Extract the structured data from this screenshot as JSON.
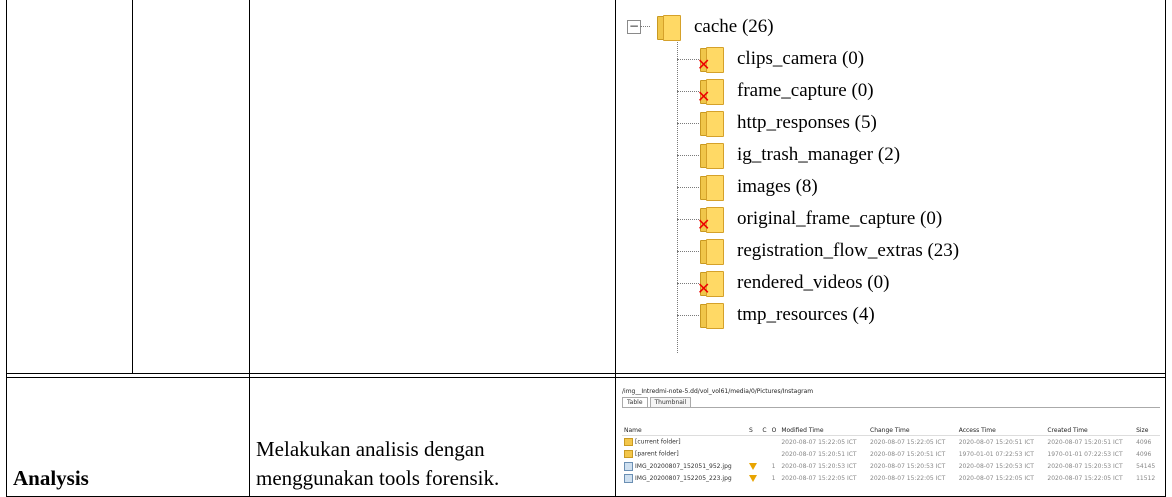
{
  "table": {
    "analysis_label": "Analysis",
    "analysis_desc_line1": "Melakukan analisis dengan",
    "analysis_desc_line2": "menggunakan tools forensik."
  },
  "tree": {
    "expander_symbol": "−",
    "root": "cache (26)",
    "children": [
      {
        "label": "clips_camera (0)",
        "deleted": true
      },
      {
        "label": "frame_capture (0)",
        "deleted": true
      },
      {
        "label": "http_responses (5)",
        "deleted": false
      },
      {
        "label": "ig_trash_manager (2)",
        "deleted": false
      },
      {
        "label": "images (8)",
        "deleted": false
      },
      {
        "label": "original_frame_capture (0)",
        "deleted": true
      },
      {
        "label": "registration_flow_extras (23)",
        "deleted": false
      },
      {
        "label": "rendered_videos (0)",
        "deleted": true
      },
      {
        "label": "tmp_resources (4)",
        "deleted": false
      }
    ]
  },
  "screenshot": {
    "path": "/img__Intredmi-note-5.dd/vol_vol61/media/0/Pictures/Instagram",
    "tabs": [
      "Table",
      "Thumbnail"
    ],
    "columns": [
      "Name",
      "S",
      "C",
      "O",
      "Modified Time",
      "Change Time",
      "Access Time",
      "Created Time",
      "Size"
    ],
    "rows": [
      {
        "name": "[current folder]",
        "type": "folder",
        "s": "",
        "c": "",
        "o": "",
        "modified": "2020-08-07 15:22:05 ICT",
        "change": "2020-08-07 15:22:05 ICT",
        "access": "2020-08-07 15:20:51 ICT",
        "created": "2020-08-07 15:20:51 ICT",
        "size": "4096"
      },
      {
        "name": "[parent folder]",
        "type": "folder",
        "s": "",
        "c": "",
        "o": "",
        "modified": "2020-08-07 15:20:51 ICT",
        "change": "2020-08-07 15:20:51 ICT",
        "access": "1970-01-01 07:22:53 ICT",
        "created": "1970-01-01 07:22:53 ICT",
        "size": "4096"
      },
      {
        "name": "IMG_20200807_152051_952.jpg",
        "type": "image",
        "s": "warn",
        "c": "",
        "o": "1",
        "modified": "2020-08-07 15:20:53 ICT",
        "change": "2020-08-07 15:20:53 ICT",
        "access": "2020-08-07 15:20:53 ICT",
        "created": "2020-08-07 15:20:53 ICT",
        "size": "54145"
      },
      {
        "name": "IMG_20200807_152205_223.jpg",
        "type": "image",
        "s": "warn",
        "c": "",
        "o": "1",
        "modified": "2020-08-07 15:22:05 ICT",
        "change": "2020-08-07 15:22:05 ICT",
        "access": "2020-08-07 15:22:05 ICT",
        "created": "2020-08-07 15:22:05 ICT",
        "size": "11512"
      }
    ]
  }
}
